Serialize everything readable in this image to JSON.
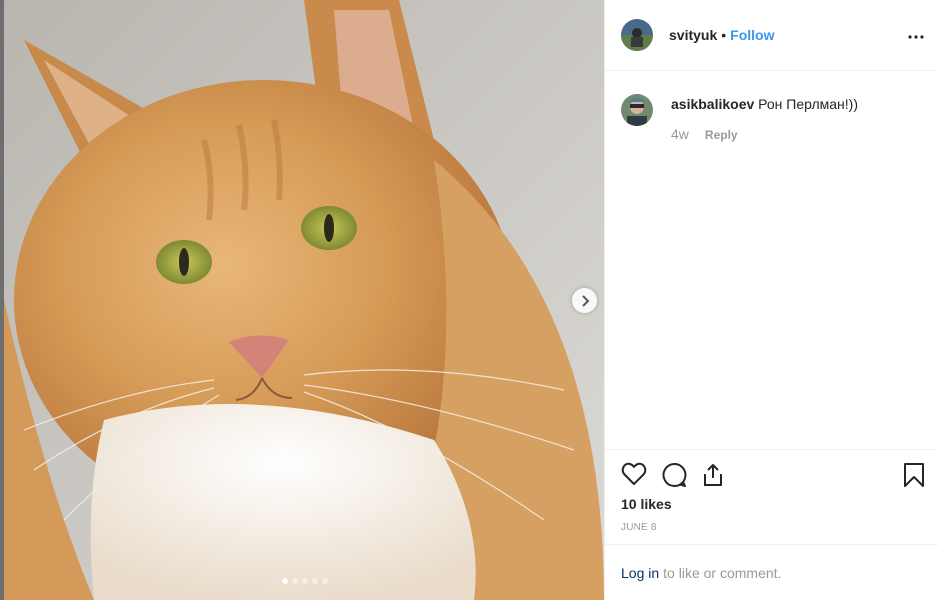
{
  "post": {
    "username": "svityuk",
    "separator": "•",
    "follow_label": "Follow",
    "more_icon": "more-options-icon",
    "likes_text": "10 likes",
    "date_text": "JUNE 8"
  },
  "media": {
    "image_alt": "Orange Maine Coon cat",
    "carousel_count": 5,
    "carousel_active": 0,
    "next_icon": "chevron-right-icon"
  },
  "comments": [
    {
      "username": "asikbalikoev",
      "text": "Рон Перлман!))",
      "time": "4w",
      "reply_label": "Reply"
    }
  ],
  "login": {
    "link_label": "Log in",
    "suffix_text": "to like or comment."
  },
  "colors": {
    "link_blue": "#3897f0",
    "text_dark": "#262626",
    "muted": "#999999",
    "login_blue": "#003569"
  }
}
